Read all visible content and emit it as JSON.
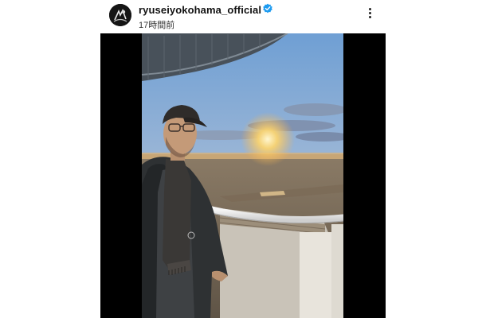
{
  "post": {
    "username": "ryuseiyokohama_official",
    "verified": true,
    "time_ago": "17時間前",
    "avatar_icon": "profile-avatar-icon",
    "verified_icon": "verified-badge-icon",
    "more_icon": "more-options-icon",
    "photo": "sunset-balcony-photo"
  },
  "colors": {
    "verified_badge": "#1d9bf0",
    "text_primary": "#111111",
    "photo_bars": "#000000"
  }
}
